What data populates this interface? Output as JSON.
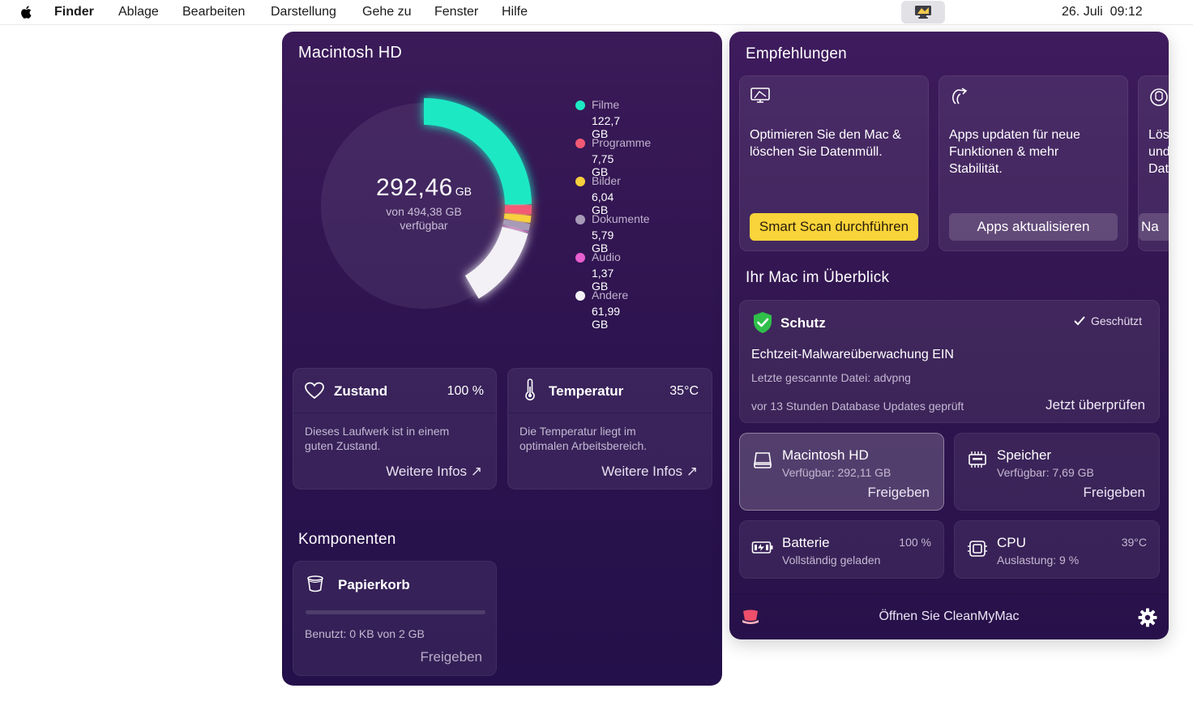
{
  "menubar": {
    "app": "Finder",
    "items": [
      "Ablage",
      "Bearbeiten",
      "Darstellung",
      "Gehe zu",
      "Fenster",
      "Hilfe"
    ],
    "clock": "26. Juli  09:12"
  },
  "disk": {
    "title": "Macintosh HD",
    "used_value": "292,46",
    "used_unit": "GB",
    "sub_line1": "von 494,38 GB",
    "sub_line2": "verfügbar",
    "legend": [
      {
        "name": "Filme",
        "size": "122,7 GB",
        "color": "#1de9c4"
      },
      {
        "name": "Programme",
        "size": "7,75 GB",
        "color": "#f35a74"
      },
      {
        "name": "Bilder",
        "size": "6,04 GB",
        "color": "#f8cf3c"
      },
      {
        "name": "Dokumente",
        "size": "5,79 GB",
        "color": "#a79bb8"
      },
      {
        "name": "Audio",
        "size": "1,37 GB",
        "color": "#e85fd0"
      },
      {
        "name": "Andere",
        "size": "61,99 GB",
        "color": "#f3f1f6"
      }
    ]
  },
  "zustand": {
    "title": "Zustand",
    "value": "100 %",
    "desc_line1": "Dieses Laufwerk ist in einem",
    "desc_line2": "guten Zustand.",
    "link": "Weitere Infos ↗"
  },
  "temperatur": {
    "title": "Temperatur",
    "value": "35°C",
    "desc_line1": "Die Temperatur liegt im",
    "desc_line2": "optimalen Arbeitsbereich.",
    "link": "Weitere Infos ↗"
  },
  "komponenten": {
    "title": "Komponenten",
    "papierkorb": {
      "title": "Papierkorb",
      "used_fraction": 0,
      "usage": "Benutzt: 0 KB von 2 GB",
      "action": "Freigeben"
    }
  },
  "recommendations": {
    "title": "Empfehlungen",
    "cards": [
      {
        "text_line1": "Optimieren Sie den Mac &",
        "text_line2": "löschen Sie Datenmüll.",
        "text_line3": "",
        "button": "Smart Scan durchführen"
      },
      {
        "text_line1": "Apps updaten für neue",
        "text_line2": "Funktionen & mehr",
        "text_line3": "Stabilität.",
        "button": "Apps aktualisieren"
      },
      {
        "text_line1": "Lös",
        "text_line2": "und",
        "text_line3": "Dat",
        "button": "Na"
      }
    ]
  },
  "overview": {
    "title": "Ihr Mac im Überblick",
    "schutz": {
      "title": "Schutz",
      "status": "Geschützt",
      "line1": "Echtzeit-Malwareüberwachung EIN",
      "line2": "Letzte gescannte Datei: advpng",
      "line3": "vor 13 Stunden Database Updates geprüft",
      "action": "Jetzt überprüfen"
    },
    "macintosh": {
      "title": "Macintosh HD",
      "sub": "Verfügbar: 292,11 GB",
      "action": "Freigeben"
    },
    "speicher": {
      "title": "Speicher",
      "sub": "Verfügbar: 7,69 GB",
      "action": "Freigeben"
    },
    "batterie": {
      "title": "Batterie",
      "sub": "Vollständig geladen",
      "value": "100 %"
    },
    "cpu": {
      "title": "CPU",
      "sub": "Auslastung: 9 %",
      "value": "39°C"
    }
  },
  "footer": {
    "open_label": "Öffnen Sie CleanMyMac"
  },
  "colors": {
    "accent_yellow": "#f9d43a",
    "teal": "#1de9c4",
    "shield_green": "#2fbf4a"
  }
}
